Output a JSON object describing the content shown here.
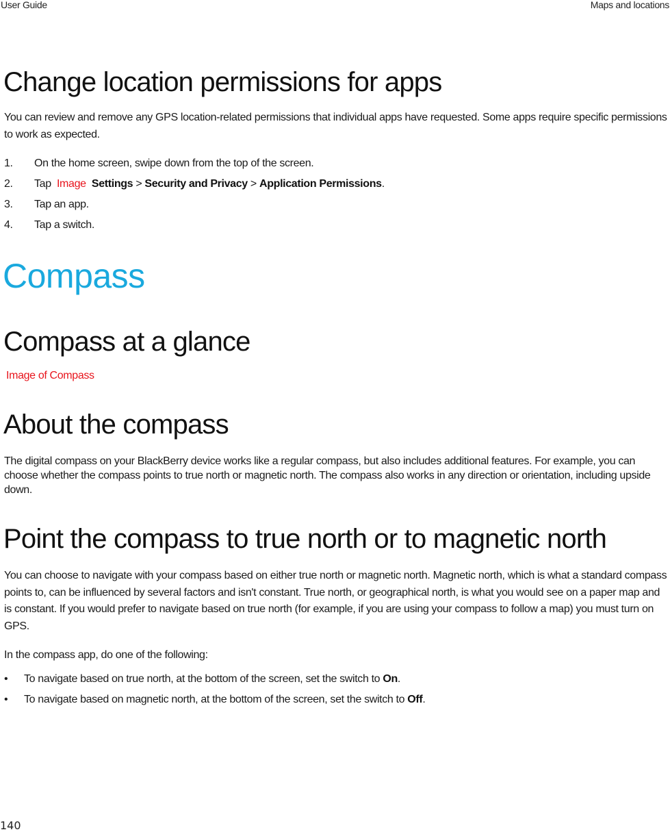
{
  "header": {
    "left": "User Guide",
    "right": "Maps and locations"
  },
  "section_permissions": {
    "title": "Change location permissions for apps",
    "intro": "You can review and remove any GPS location-related permissions that individual apps have requested. Some apps require specific permissions to work as expected.",
    "steps": [
      {
        "num": "1.",
        "text": "On the home screen, swipe down from the top of the screen."
      },
      {
        "num": "2.",
        "prefix": "Tap ",
        "image_placeholder": "Image",
        "path": [
          "Settings",
          "Security and Privacy",
          "Application Permissions"
        ],
        "separator": " > ",
        "suffix": "."
      },
      {
        "num": "3.",
        "text": "Tap an app."
      },
      {
        "num": "4.",
        "text": "Tap a switch."
      }
    ]
  },
  "chapter": {
    "title": "Compass",
    "accent_color": "#1aa9de"
  },
  "section_glance": {
    "title": "Compass at a glance",
    "image_placeholder": "Image of Compass"
  },
  "section_about": {
    "title": "About the compass",
    "body": "The digital compass on your BlackBerry device works like a regular compass, but also includes additional features. For example, you can choose whether the compass points to true north or magnetic north. The compass also works in any direction or orientation, including upside down."
  },
  "section_point": {
    "title": "Point the compass to true north or to magnetic north",
    "body": "You can choose to navigate with your compass based on either true north or magnetic north. Magnetic north, which is what a standard compass points to, can be influenced by several factors and isn't constant. True north, or geographical north, is what you would see on a paper map and is constant. If you would prefer to navigate based on true north (for example, if you are using your compass to follow a map) you must turn on GPS.",
    "lead": "In the compass app, do one of the following:",
    "bullets": [
      {
        "bullet": "•",
        "text": "To navigate based on true north, at the bottom of the screen, set the switch to ",
        "bold": "On",
        "suffix": "."
      },
      {
        "bullet": "•",
        "text": "To navigate based on magnetic north, at the bottom of the screen, set the switch to ",
        "bold": "Off",
        "suffix": "."
      }
    ]
  },
  "footer": {
    "page_number": "140"
  }
}
